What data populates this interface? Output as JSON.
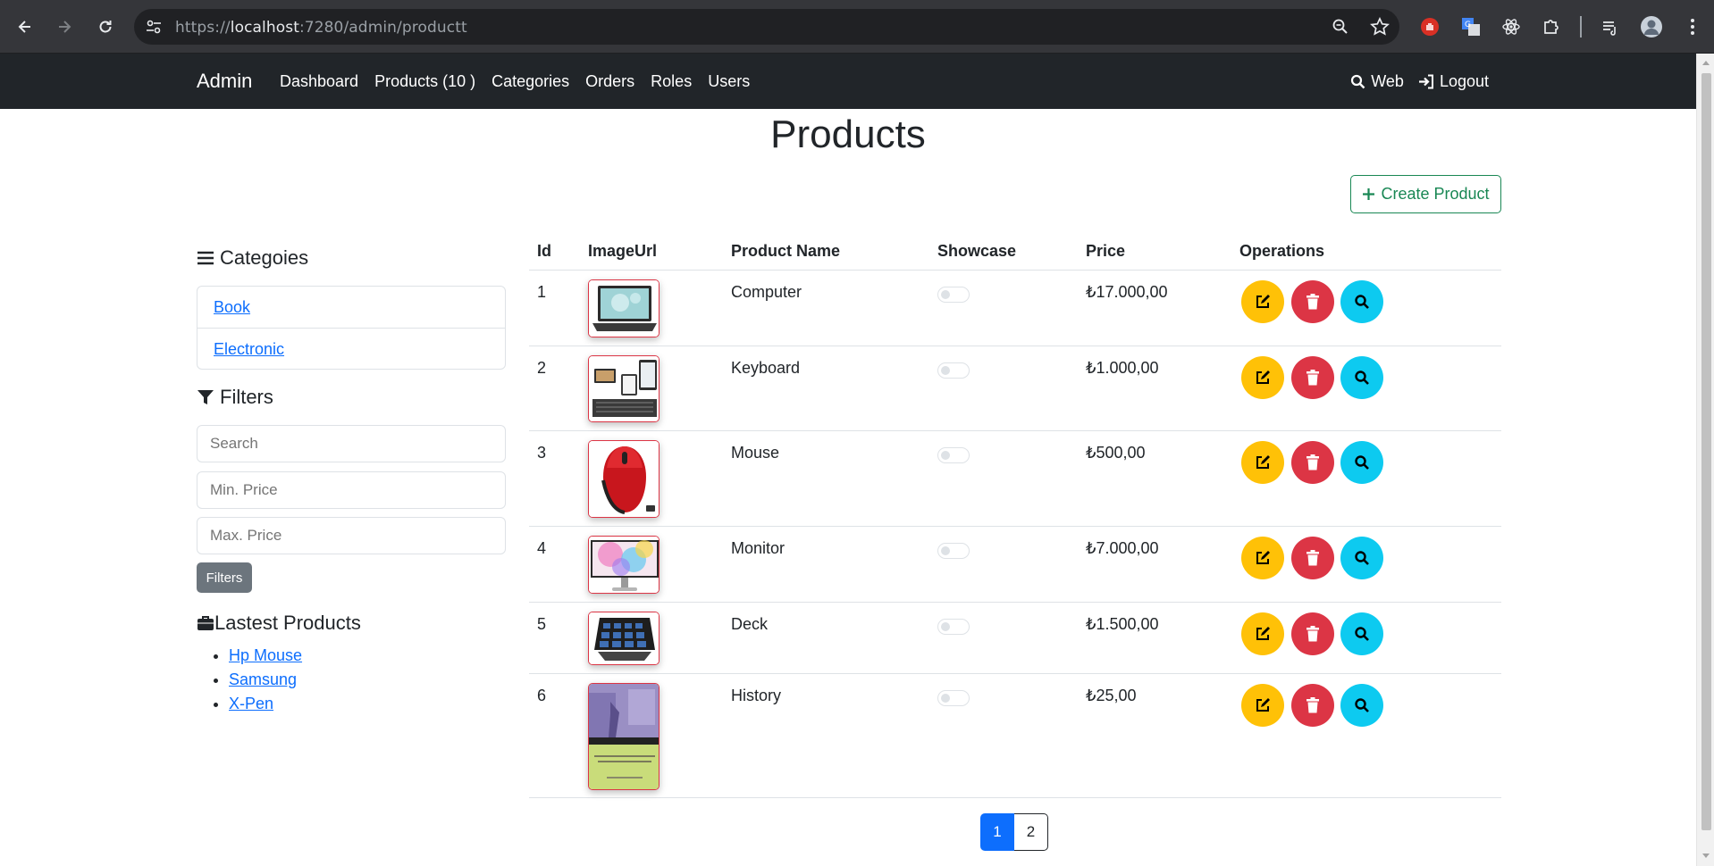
{
  "browser": {
    "url_prefix": "https://",
    "url_host": "localhost",
    "url_rest": ":7280/admin/productt"
  },
  "navbar": {
    "brand": "Admin",
    "links": [
      {
        "label": "Dashboard"
      },
      {
        "label": "Products (10 )"
      },
      {
        "label": "Categories"
      },
      {
        "label": "Orders"
      },
      {
        "label": "Roles"
      },
      {
        "label": "Users"
      }
    ],
    "web_label": "Web",
    "logout_label": "Logout"
  },
  "page": {
    "title": "Products",
    "create_button": "Create Product"
  },
  "sidebar": {
    "categories_heading": "Categoies",
    "categories": [
      {
        "label": "Book"
      },
      {
        "label": "Electronic"
      }
    ],
    "filters_heading": "Filters",
    "search_placeholder": "Search",
    "min_price_placeholder": "Min. Price",
    "max_price_placeholder": "Max. Price",
    "filter_button": "Filters",
    "latest_heading": "Lastest Products",
    "latest": [
      {
        "label": "Hp Mouse"
      },
      {
        "label": "Samsung"
      },
      {
        "label": "X-Pen"
      }
    ]
  },
  "table": {
    "headers": {
      "id": "Id",
      "image": "ImageUrl",
      "name": "Product Name",
      "showcase": "Showcase",
      "price": "Price",
      "operations": "Operations"
    },
    "rows": [
      {
        "id": "1",
        "name": "Computer",
        "price": "₺17.000,00",
        "showcase": false,
        "image": "laptop"
      },
      {
        "id": "2",
        "name": "Keyboard",
        "price": "₺1.000,00",
        "showcase": false,
        "image": "keyboard"
      },
      {
        "id": "3",
        "name": "Mouse",
        "price": "₺500,00",
        "showcase": false,
        "image": "mouse"
      },
      {
        "id": "4",
        "name": "Monitor",
        "price": "₺7.000,00",
        "showcase": false,
        "image": "monitor"
      },
      {
        "id": "5",
        "name": "Deck",
        "price": "₺1.500,00",
        "showcase": false,
        "image": "stream-deck"
      },
      {
        "id": "6",
        "name": "History",
        "price": "₺25,00",
        "showcase": false,
        "image": "book-cover"
      }
    ]
  },
  "pagination": {
    "pages": [
      "1",
      "2"
    ],
    "current": "1"
  },
  "colors": {
    "navbar_bg": "#212529",
    "success": "#198754",
    "warning": "#ffc107",
    "danger": "#dc3545",
    "info": "#0dcaf0",
    "primary": "#0d6efd",
    "secondary": "#6c757d"
  }
}
